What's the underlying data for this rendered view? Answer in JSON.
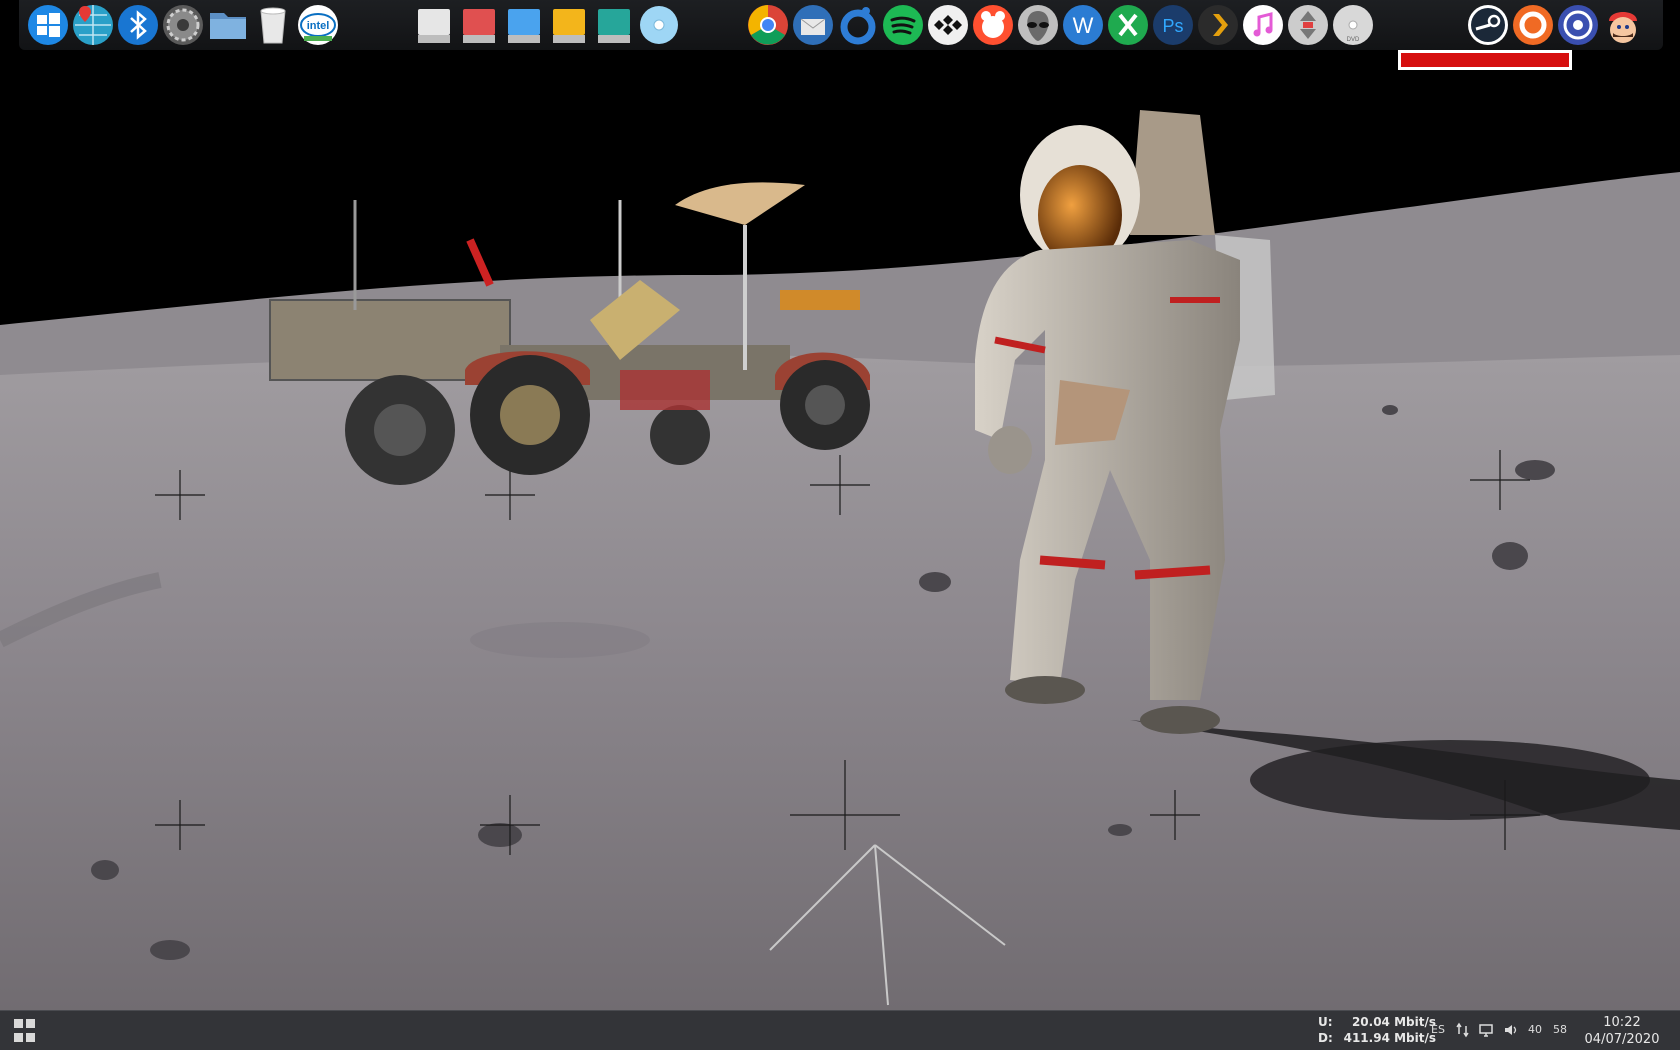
{
  "wallpaper": {
    "icon": "moon-landing-wallpaper"
  },
  "dock": {
    "system_icons": [
      {
        "name": "windows-start-icon",
        "color": "#1e88e5"
      },
      {
        "name": "maps-globe-icon",
        "color": "#2aa0c8"
      },
      {
        "name": "bluetooth-icon",
        "color": "#1976d2"
      },
      {
        "name": "settings-gear-icon",
        "color": "#8a8a8a"
      },
      {
        "name": "folder-icon",
        "color": "#7fb2e0"
      },
      {
        "name": "trash-icon",
        "color": "#e8e8e8"
      },
      {
        "name": "intel-icon",
        "color": "#0a6fc2"
      }
    ],
    "drive_icons": [
      {
        "name": "drive-white-icon",
        "color": "#e6e6e6"
      },
      {
        "name": "drive-red-icon",
        "color": "#e05050"
      },
      {
        "name": "drive-blue-icon",
        "color": "#4aa3ee"
      },
      {
        "name": "drive-yellow-icon",
        "color": "#f3b51b"
      },
      {
        "name": "drive-teal-icon",
        "color": "#26a69a"
      },
      {
        "name": "optical-disc-icon",
        "color": "#9ed6f5"
      }
    ],
    "app_icons": [
      {
        "name": "chrome-icon",
        "color": "#db4437"
      },
      {
        "name": "thunderbird-icon",
        "color": "#2f6fb8"
      },
      {
        "name": "origin-icon",
        "color": "#2e7dd6"
      },
      {
        "name": "spotify-icon",
        "color": "#1db954"
      },
      {
        "name": "tidal-icon",
        "color": "#f0f0f0"
      },
      {
        "name": "gom-player-icon",
        "color": "#ff5030"
      },
      {
        "name": "alien-icon",
        "color": "#bfbfbf"
      },
      {
        "name": "word-icon",
        "color": "#2b7cd3"
      },
      {
        "name": "excel-icon",
        "color": "#1faa4f"
      },
      {
        "name": "photoshop-icon",
        "color": "#1b3c6b"
      },
      {
        "name": "plex-icon",
        "color": "#e5a00d"
      },
      {
        "name": "itunes-icon",
        "color": "#e45bd6"
      },
      {
        "name": "transfer-icon",
        "color": "#cccccc"
      },
      {
        "name": "dvd-icon",
        "color": "#d8d8d8"
      }
    ],
    "end_icons": [
      {
        "name": "steam-icon",
        "color": "#1b2838"
      },
      {
        "name": "ccleaner-icon",
        "color": "#f06a24"
      },
      {
        "name": "ubisoft-icon",
        "color": "#3a4fb0"
      },
      {
        "name": "mario-icon",
        "color": "#e53935"
      }
    ],
    "intel_label": "intel",
    "dvd_label": "DVD",
    "photoshop_label": "Ps",
    "word_label": "W"
  },
  "taskbar": {
    "start_icon": "windows-start-icon",
    "net": {
      "upload_label": "U:",
      "upload_value": "20.04 Mbit/s",
      "download_label": "D:",
      "download_value": "411.94 Mbit/s"
    },
    "language": "ES",
    "tray_value_1": "40",
    "tray_value_2": "58",
    "time": "10:22",
    "date": "04/07/2020"
  }
}
